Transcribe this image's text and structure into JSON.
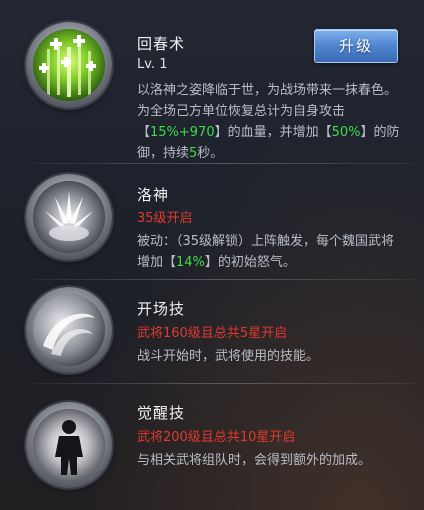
{
  "skills": [
    {
      "name": "回春术",
      "level": "Lv. 1",
      "desc_parts": {
        "a": "以洛神之姿降临于世，为战场带来一抹春色。为全场己方单位恢复总计为自身攻击【",
        "b": "15%+970",
        "c": "】的血量，并增加【",
        "d": "50%",
        "e": "】的防御，持续",
        "f": "5",
        "g": "秒。"
      },
      "icon": "spring-heal-icon",
      "button": "升级"
    },
    {
      "name": "洛神",
      "status": "35级开启",
      "desc_parts": {
        "a": "被动：（35级解锁）上阵触发，每个魏国武将增加【",
        "b": "14%",
        "c": "】的初始怒气。"
      },
      "icon": "luoshen-lotus-icon"
    },
    {
      "name": "开场技",
      "status": "武将160级且总共5星开启",
      "desc": "战斗开始时，武将使用的技能。",
      "icon": "opening-swirl-icon"
    },
    {
      "name": "觉醒技",
      "status": "武将200级且总共10星开启",
      "desc": "与相关武将组队时，会得到额外的加成。",
      "icon": "awaken-figure-icon"
    }
  ],
  "colors": {
    "highlight": "#3ddc4a",
    "status_red": "#e2392e",
    "button_blue": "#4f85cf"
  }
}
